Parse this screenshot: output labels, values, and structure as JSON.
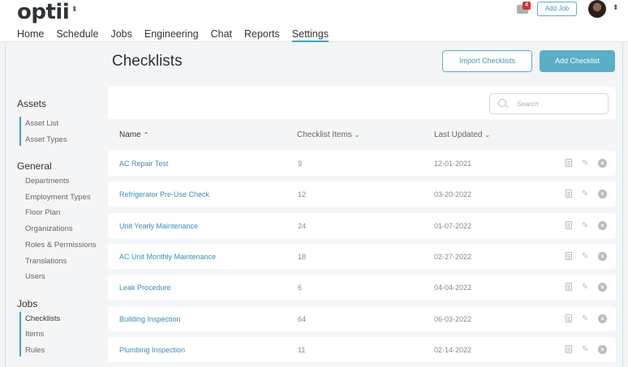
{
  "app": {
    "logo": "optii",
    "logo_caret": "⬍"
  },
  "nav": [
    {
      "label": "Home"
    },
    {
      "label": "Schedule"
    },
    {
      "label": "Jobs"
    },
    {
      "label": "Engineering"
    },
    {
      "label": "Chat"
    },
    {
      "label": "Reports"
    },
    {
      "label": "Settings",
      "active": true
    }
  ],
  "header": {
    "chat_badge": "4",
    "add_job_label": "Add Job"
  },
  "sidebar": {
    "sections": [
      {
        "title": "Assets",
        "items": [
          "Asset List",
          "Asset Types"
        ]
      },
      {
        "title": "General",
        "items": [
          "Departments",
          "Employment Types",
          "Floor Plan",
          "Organizations",
          "Roles & Permissions",
          "Translations",
          "Users"
        ]
      },
      {
        "title": "Jobs",
        "items": [
          "Checklists",
          "Items",
          "Rules"
        ]
      }
    ]
  },
  "page": {
    "title": "Checklists",
    "import_label": "Import Checklists",
    "add_label": "Add Checklist",
    "search_placeholder": "Search"
  },
  "table": {
    "columns": [
      "Name",
      "Checklist Items",
      "Last Updated"
    ],
    "rows": [
      {
        "name": "AC Repair Test",
        "items": "9",
        "updated": "12-01-2021"
      },
      {
        "name": "Refrigerator Pre-Use Check",
        "items": "12",
        "updated": "03-20-2022"
      },
      {
        "name": "Unit Yearly Maintenance",
        "items": "24",
        "updated": "01-07-2022"
      },
      {
        "name": "AC Unit Monthly Maintenance",
        "items": "18",
        "updated": "02-27-2022"
      },
      {
        "name": "Leak Procedure",
        "items": "6",
        "updated": "04-04-2022"
      },
      {
        "name": "Building Inspection",
        "items": "64",
        "updated": "06-03-2022"
      },
      {
        "name": "Plumbing Inspection",
        "items": "11",
        "updated": "02-14-2022"
      }
    ]
  },
  "colors": {
    "accent": "#5aaec6",
    "link": "#3a8eaf",
    "badge": "#d9312b"
  }
}
